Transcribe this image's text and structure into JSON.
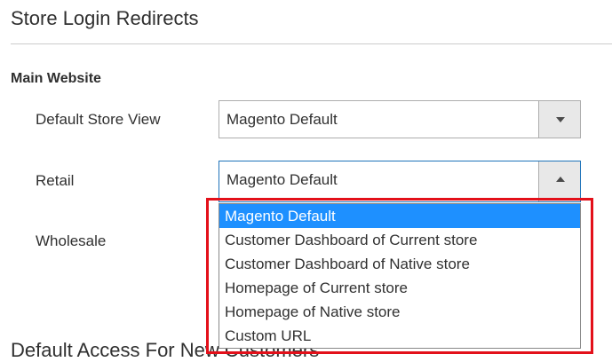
{
  "section": {
    "title": "Store Login Redirects"
  },
  "group": {
    "title": "Main Website"
  },
  "fields": {
    "default_store_view": {
      "label": "Default Store View",
      "value": "Magento Default"
    },
    "retail": {
      "label": "Retail",
      "value": "Magento Default"
    },
    "wholesale": {
      "label": "Wholesale"
    }
  },
  "dropdown": {
    "options": [
      "Magento Default",
      "Customer Dashboard of Current store",
      "Customer Dashboard of Native store",
      "Homepage of Current store",
      "Homepage of Native store",
      "Custom URL"
    ],
    "selected_index": 0
  },
  "next_section": {
    "title": "Default Access For New Customers"
  },
  "colors": {
    "highlight_frame": "#e3101a",
    "selected_option_bg": "#1e90ff",
    "focus_border": "#1e73b9"
  }
}
